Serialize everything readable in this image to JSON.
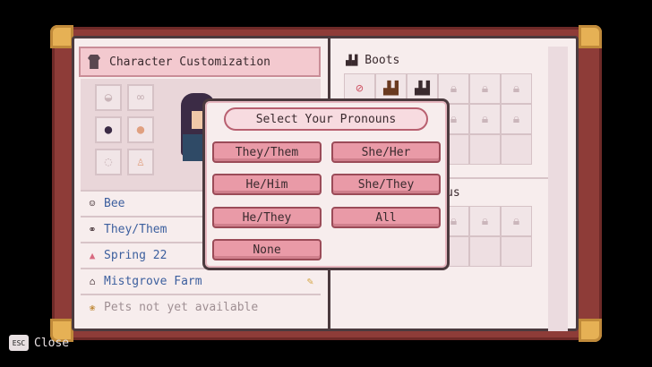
{
  "left_page": {
    "header_title": "Character Customization",
    "info": {
      "name": "Bee",
      "pronouns": "They/Them",
      "birthday": "Spring 22",
      "farm": "Mistgrove Farm",
      "pets": "Pets not yet available"
    }
  },
  "right_page": {
    "boots_title": "Boots",
    "partial_section_title": "us"
  },
  "modal": {
    "title": "Select Your Pronouns",
    "options": [
      "They/Them",
      "She/Her",
      "He/Him",
      "She/They",
      "He/They",
      "All",
      "None"
    ]
  },
  "footer": {
    "esc_key": "ESC",
    "close_label": "Close"
  },
  "colors": {
    "book_cover": "#8e3c38",
    "page": "#f7eded",
    "header_pink": "#f3c9cf",
    "button_pink": "#e99aa7",
    "link_blue": "#3c5f9e"
  }
}
